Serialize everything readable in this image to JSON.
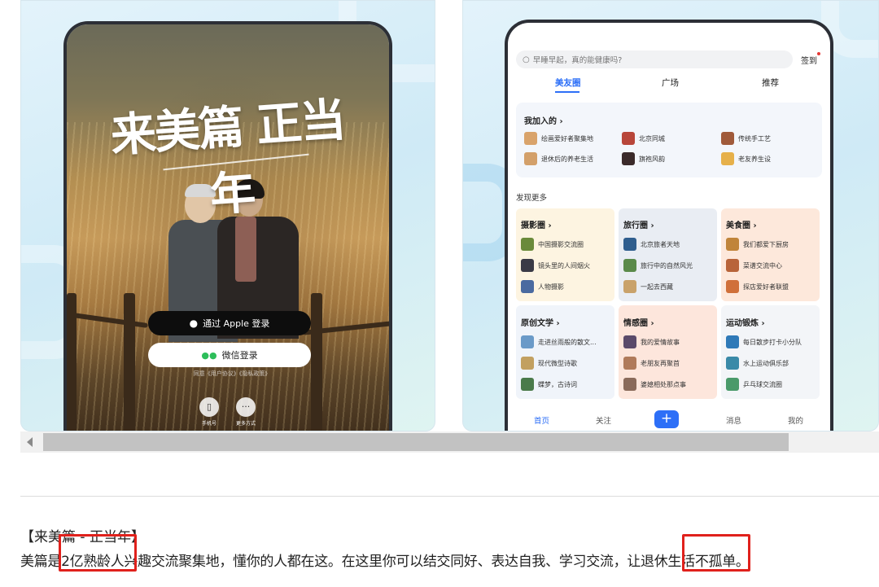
{
  "login_screen": {
    "slogan": "来美篇 正当年",
    "apple_login": "通过 Apple 登录",
    "wechat_login": "微信登录",
    "agreement": "同意《用户协议》《隐私政策》",
    "alt_methods": [
      {
        "label": "手机号",
        "icon": "phone-icon"
      },
      {
        "label": "更多方式",
        "icon": "more-icon"
      }
    ]
  },
  "app_screen": {
    "search_placeholder": "早睡早起，真的能健康吗?",
    "signin": "签到",
    "tabs": [
      "美友圈",
      "广场",
      "推荐"
    ],
    "active_tab": 0,
    "joined_title": "我加入的",
    "joined_groups": [
      {
        "name": "绘画爱好者聚集地",
        "color": "#d9a36b"
      },
      {
        "name": "北京同城",
        "color": "#b8463a"
      },
      {
        "name": "传统手工艺",
        "color": "#a05a3a"
      },
      {
        "name": "退休后的养老生活",
        "color": "#d3a06a"
      },
      {
        "name": "旗袍风韵",
        "color": "#3b2a2a"
      },
      {
        "name": "老友养生设",
        "color": "#e6b04a"
      }
    ],
    "discover_title": "发现更多",
    "categories": [
      {
        "title": "摄影圈",
        "bg": "#fdf4e1",
        "items": [
          "中国摄影交流圈",
          "镜头里的人间烟火",
          "人物摄影"
        ],
        "colors": [
          "#6a8a3a",
          "#3a3a46",
          "#4a6aa0"
        ]
      },
      {
        "title": "旅行圈",
        "bg": "#e9edf3",
        "items": [
          "北京旅者天地",
          "旅行中的自然风光",
          "一起去西藏"
        ],
        "colors": [
          "#2f5e8e",
          "#5a8a4a",
          "#c9a26a"
        ]
      },
      {
        "title": "美食圈",
        "bg": "#fde8db",
        "items": [
          "我们都爱下厨房",
          "菜谱交流中心",
          "探店爱好者联盟"
        ],
        "colors": [
          "#c0843a",
          "#b8643a",
          "#d0703a"
        ]
      },
      {
        "title": "原创文学",
        "bg": "#f0f4fa",
        "items": [
          "走进丝雨般的散文...",
          "现代微型诗歌",
          "蝶梦，古诗词"
        ],
        "colors": [
          "#6a9ac8",
          "#c2a060",
          "#4a7a4a"
        ]
      },
      {
        "title": "情感圈",
        "bg": "#fde6dc",
        "items": [
          "我的爱情故事",
          "老朋友再聚首",
          "婆媳相处那点事"
        ],
        "colors": [
          "#5a4a6a",
          "#b07a5a",
          "#8a6a5a"
        ]
      },
      {
        "title": "运动锻炼",
        "bg": "#f3f5f8",
        "items": [
          "每日散步打卡小分队",
          "水上运动俱乐部",
          "乒乓球交流圈"
        ],
        "colors": [
          "#2f7ab8",
          "#3a8aa8",
          "#4a9a6a"
        ]
      }
    ],
    "nav": [
      "首页",
      "关注",
      "+",
      "消息",
      "我的"
    ]
  },
  "caption": {
    "title": "【来美篇 - 正当年】",
    "body": "美篇是2亿熟龄人兴趣交流聚集地，懂你的人都在这。在这里你可以结交同好、表达自我、学习交流，让退休生活不孤单。"
  },
  "colors": {
    "accent": "#2d6ff7",
    "highlight": "#e0211c"
  }
}
